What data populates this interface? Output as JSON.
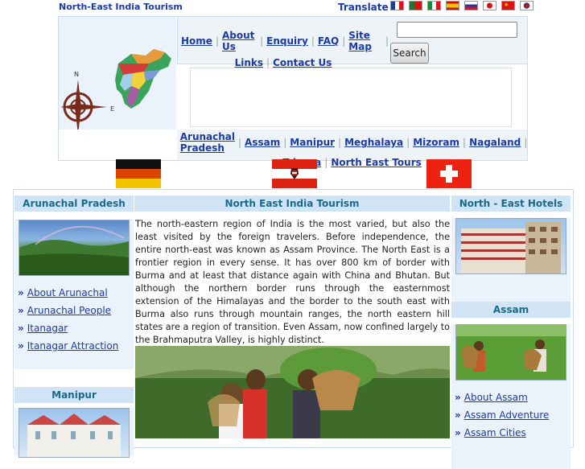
{
  "site_title": "North-East India Tourism",
  "translate_label": "Translate :",
  "translate_flags": [
    "french-flag-icon",
    "portuguese-flag-icon",
    "italian-flag-icon",
    "spanish-flag-icon",
    "russian-flag-icon",
    "japanese-flag-icon",
    "chinese-flag-icon",
    "korean-flag-icon"
  ],
  "menu": {
    "items": [
      "Home",
      "About Us",
      "Enquiry",
      "FAQ",
      "Site Map",
      "Links",
      "Contact Us"
    ]
  },
  "search": {
    "value": "",
    "button_label": "Search"
  },
  "logo_compass": {
    "north": "N",
    "east": "E"
  },
  "states": [
    "Arunachal Pradesh",
    "Assam",
    "Manipur",
    "Meghalaya",
    "Mizoram",
    "Nagaland",
    "Tripura",
    "North East Tours"
  ],
  "left_sidebar": {
    "section1_title": "Arunachal Pradesh",
    "section1_links": [
      "About Arunachal",
      "Arunachal People",
      "Itanagar",
      "Itanagar Attraction"
    ],
    "section2_title": "Manipur"
  },
  "center": {
    "title": "North East India Tourism",
    "body": "The north-eastern region of India is the most varied, but also the least visited by the foreign travelers. Before independence, the entire north-east was known as Assam Province. The North East is a frontier region in every sense. It has over 800 km of border with Burma and at least that distance again with China and Bhutan. But although the northern border runs through the easternmost extension of the Himalayas and the border to the south east with Burma also runs through mountain ranges, the north eastern hill states are a region of transition. Even Assam, now confined largely to the Brahmaputra Valley, is highly distinct."
  },
  "right_sidebar": {
    "section1_title": "North - East Hotels",
    "section2_title": "Assam",
    "section2_links": [
      "About Assam",
      "Assam Adventure",
      "Assam Cities"
    ]
  },
  "colors": {
    "link": "#1a3aa8",
    "heading_bg": "#d0e4f6",
    "panel_bg": "#eaf2fb",
    "heading_text": "#1a6a8a"
  }
}
